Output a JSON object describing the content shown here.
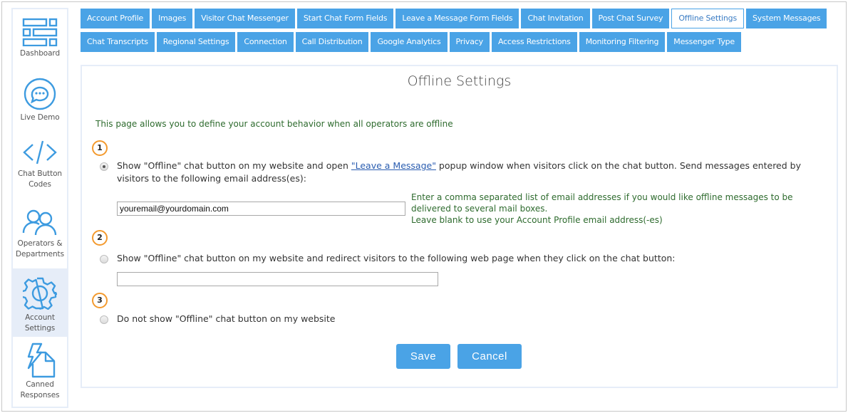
{
  "sidebar": {
    "items": [
      {
        "label_line1": "Dashboard",
        "label_line2": "",
        "icon": "dashboard-icon",
        "active": false
      },
      {
        "label_line1": "Live Demo",
        "label_line2": "",
        "icon": "chat-bubble-icon",
        "active": false
      },
      {
        "label_line1": "Chat Button",
        "label_line2": "Codes",
        "icon": "code-icon",
        "active": false
      },
      {
        "label_line1": "Operators &",
        "label_line2": "Departments",
        "icon": "users-icon",
        "active": false
      },
      {
        "label_line1": "Account",
        "label_line2": "Settings",
        "icon": "gear-icon",
        "active": true
      },
      {
        "label_line1": "Canned",
        "label_line2": "Responses",
        "icon": "canned-responses-icon",
        "active": false
      }
    ]
  },
  "tabs": {
    "row1": [
      "Account Profile",
      "Images",
      "Visitor Chat Messenger",
      "Start Chat Form Fields",
      "Leave a Message Form Fields",
      "Chat Invitation",
      "Post Chat Survey",
      "Offline Settings",
      "System Messages"
    ],
    "row2": [
      "Chat Transcripts",
      "Regional Settings",
      "Connection",
      "Call Distribution",
      "Google Analytics",
      "Privacy",
      "Access Restrictions",
      "Monitoring Filtering",
      "Messenger Type"
    ],
    "active": "Offline Settings"
  },
  "main": {
    "title": "Offline Settings",
    "intro": "This page allows you to define your account behavior when all operators are offline",
    "options": [
      {
        "step": "1",
        "checked": true,
        "text_before_link": "Show \"Offline\" chat button on my website and open ",
        "link_text": "\"Leave a Message\"",
        "text_after_link": " popup window when visitors click on the chat button. Send messages entered by visitors to the following email address(es):",
        "input_value": "youremail@yourdomain.com",
        "hint_line1": "Enter a comma separated list of email addresses if you would like offline messages to be delivered to several mail boxes.",
        "hint_line2": "Leave blank to use your Account Profile email address(-es)"
      },
      {
        "step": "2",
        "checked": false,
        "text": "Show \"Offline\" chat button on my website and redirect visitors to the following web page when they click on the chat button:",
        "input_value": ""
      },
      {
        "step": "3",
        "checked": false,
        "text": "Do not show \"Offline\" chat button on my website"
      }
    ],
    "save_label": "Save",
    "cancel_label": "Cancel"
  },
  "colors": {
    "accent": "#4aa3e6",
    "step_ring": "#f39a2e",
    "hint_text": "#2e6b2e",
    "sidebar_active": "#e6edf8",
    "link": "#2a5db0"
  }
}
